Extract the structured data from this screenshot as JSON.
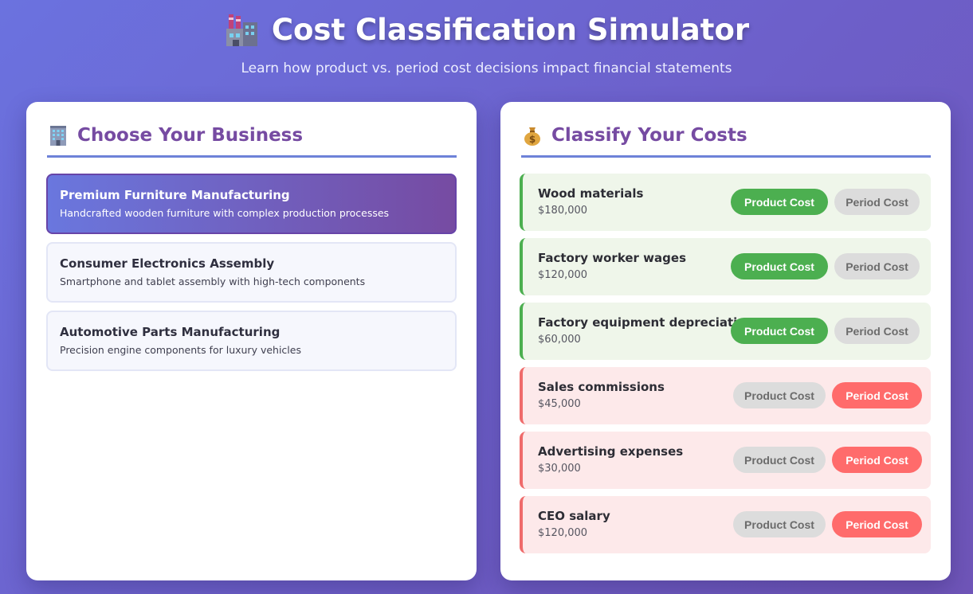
{
  "header": {
    "title": "Cost Classification Simulator",
    "title_icon": "factory-icon",
    "subtitle": "Learn how product vs. period cost decisions impact financial statements"
  },
  "business_panel": {
    "icon": "office-building-icon",
    "heading": "Choose Your Business",
    "businesses": [
      {
        "name": "Premium Furniture Manufacturing",
        "description": "Handcrafted wooden furniture with complex production processes",
        "selected": true
      },
      {
        "name": "Consumer Electronics Assembly",
        "description": "Smartphone and tablet assembly with high-tech components",
        "selected": false
      },
      {
        "name": "Automotive Parts Manufacturing",
        "description": "Precision engine components for luxury vehicles",
        "selected": false
      }
    ]
  },
  "cost_panel": {
    "icon": "money-bag-icon",
    "heading": "Classify Your Costs",
    "product_label": "Product Cost",
    "period_label": "Period Cost",
    "costs": [
      {
        "name": "Wood materials",
        "amount": "$180,000",
        "classification": "product"
      },
      {
        "name": "Factory worker wages",
        "amount": "$120,000",
        "classification": "product"
      },
      {
        "name": "Factory equipment depreciation",
        "amount": "$60,000",
        "classification": "product"
      },
      {
        "name": "Sales commissions",
        "amount": "$45,000",
        "classification": "period"
      },
      {
        "name": "Advertising expenses",
        "amount": "$30,000",
        "classification": "period"
      },
      {
        "name": "CEO salary",
        "amount": "$120,000",
        "classification": "period"
      }
    ]
  },
  "colors": {
    "accent_purple": "#764ba2",
    "product_green": "#4caf50",
    "period_red": "#ff6b6b"
  }
}
